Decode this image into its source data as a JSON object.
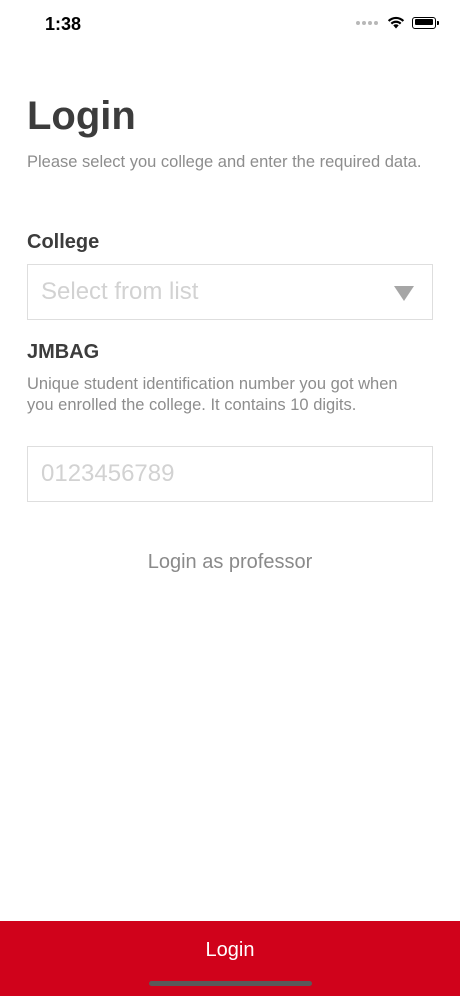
{
  "status_bar": {
    "time": "1:38",
    "icons": [
      "cellular-signal-icon",
      "wifi-icon",
      "battery-icon"
    ]
  },
  "header": {
    "title": "Login",
    "subtitle": "Please select you college and enter the required data."
  },
  "college": {
    "label": "College",
    "placeholder": "Select from list",
    "icon": "chevron-down-icon"
  },
  "jmbag": {
    "label": "JMBAG",
    "description": "Unique student identification number you got when you enrolled the college. It contains 10 digits.",
    "placeholder": "0123456789",
    "value": ""
  },
  "links": {
    "professor_login": "Login as professor"
  },
  "footer": {
    "login_label": "Login"
  },
  "colors": {
    "accent": "#d0021b",
    "text_dark": "#3c3c3c",
    "text_muted": "#8d8d8d",
    "placeholder": "#d2d2d2",
    "border": "#dedede"
  }
}
